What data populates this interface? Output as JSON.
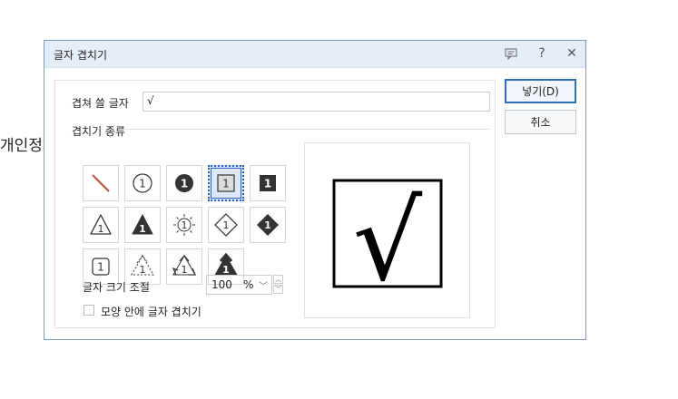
{
  "background": {
    "doc_text": "개인정"
  },
  "dialog": {
    "title": "글자 겹치기",
    "help_label": "?",
    "close_label": "✕",
    "overlap_text_label": "겹쳐 쓸 글자",
    "overlap_text_value": "√",
    "type_group_label": "겹치기 종류",
    "size_label": "글자 크기 조절",
    "size_value": "100",
    "size_unit": "%",
    "inside_shape_label": "모양 안에 글자 겹치기",
    "inside_shape_checked": false,
    "ok_button": "넣기(D)",
    "cancel_button": "취소",
    "preview_char": "√",
    "selected_type_index": 3,
    "types": [
      {
        "icon": "slash-icon"
      },
      {
        "icon": "circle-outline-icon",
        "num": "1"
      },
      {
        "icon": "circle-filled-icon",
        "num": "1"
      },
      {
        "icon": "square-outline-icon",
        "num": "1"
      },
      {
        "icon": "square-filled-icon",
        "num": "1"
      },
      {
        "icon": "triangle-outline-icon",
        "num": "1"
      },
      {
        "icon": "triangle-filled-icon",
        "num": "1"
      },
      {
        "icon": "sun-icon",
        "num": "1"
      },
      {
        "icon": "diamond-outline-icon",
        "num": "1"
      },
      {
        "icon": "diamond-filled-icon",
        "num": "1"
      },
      {
        "icon": "rounded-square-icon",
        "num": "1"
      },
      {
        "icon": "recycle-dotted-icon",
        "num": "1"
      },
      {
        "icon": "recycle-outline-icon",
        "num": "1"
      },
      {
        "icon": "recycle-filled-icon",
        "num": "1"
      }
    ]
  },
  "colors": {
    "selection": "#2b5fcf",
    "titlebar": "#e5edf8",
    "default_button_border": "#2f6fb7"
  }
}
